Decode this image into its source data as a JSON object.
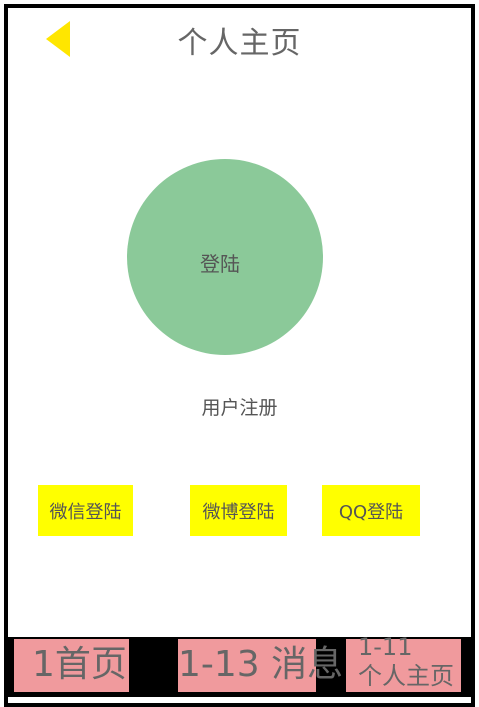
{
  "header": {
    "title": "个人主页",
    "back_icon": "back-arrow-icon"
  },
  "main": {
    "login_label": "登陆",
    "register_label": "用户注册",
    "social_logins": [
      {
        "label": "微信登陆"
      },
      {
        "label": "微博登陆"
      },
      {
        "label": "QQ登陆"
      }
    ]
  },
  "tabbar": {
    "home_label": "1首页",
    "messages_label": "1-13 消息",
    "profile_line1": "1-11",
    "profile_line2": "个人主页"
  },
  "colors": {
    "back_arrow": "#ffe600",
    "login_circle": "#8bc999",
    "social_button": "#ffff00",
    "tab_background": "#f09a9d",
    "text": "#666666",
    "border": "#000000"
  }
}
